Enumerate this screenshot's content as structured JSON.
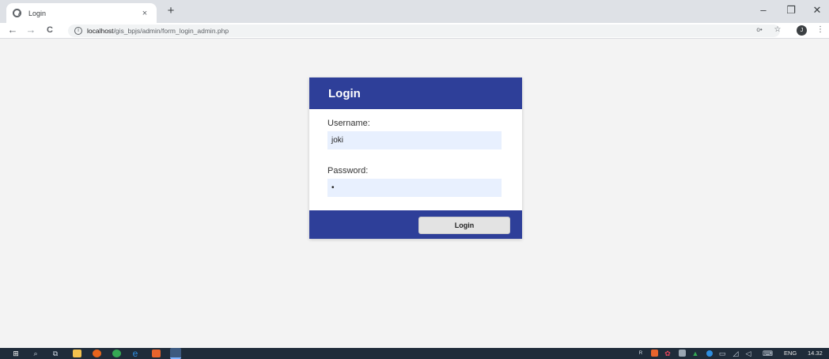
{
  "browser": {
    "tab_title": "Login",
    "tab_close": "×",
    "new_tab": "+",
    "minimize": "–",
    "maximize": "❐",
    "close": "✕",
    "back": "←",
    "forward": "→",
    "reload": "C",
    "url_host": "localhost",
    "url_path": "/gis_bpjs/admin/form_login_admin.php",
    "key_icon": "o•",
    "star_icon": "☆",
    "profile_initial": "J",
    "menu_icon": "⋮"
  },
  "login": {
    "title": "Login",
    "username_label": "Username:",
    "username_value": "joki",
    "password_label": "Password:",
    "password_value": "•",
    "submit_label": "Login"
  },
  "taskbar": {
    "language": "ENG",
    "time": "14.32",
    "apps": [
      "start",
      "search",
      "task-view",
      "file-explorer",
      "firefox",
      "chrome",
      "edge",
      "sublime",
      "chrome-active"
    ],
    "app_colors": [
      "#ffffff",
      "#ffffff",
      "#ffffff",
      "#f2c14e",
      "#e8641c",
      "#34a853",
      "#2f8ee0",
      "#e8642c",
      "#4c8bf5"
    ]
  },
  "colors": {
    "brand": "#2e3f99",
    "input_bg": "#e8f0fe",
    "page_bg": "#f3f3f3"
  }
}
